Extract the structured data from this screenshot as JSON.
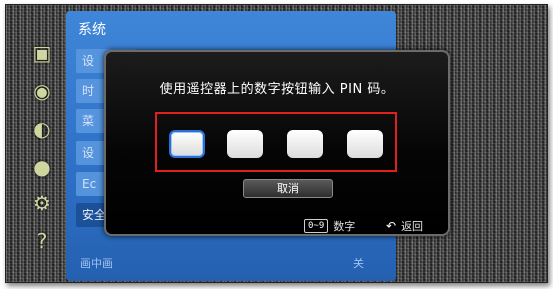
{
  "system_menu": {
    "title": "系统",
    "items": [
      {
        "label": "设"
      },
      {
        "label": "时"
      },
      {
        "label": "菜"
      },
      {
        "label": "设"
      },
      {
        "label": "Ec"
      },
      {
        "label": "安全"
      }
    ],
    "bottom_label": "画中画",
    "bottom_value": "关"
  },
  "side_icons": [
    "picture-icon",
    "sound-icon",
    "channel-icon",
    "globe-icon",
    "gear-icon",
    "help-icon"
  ],
  "pin_dialog": {
    "prompt": "使用遥控器上的数字按钮输入 PIN 码。",
    "pin_digits": [
      "",
      "",
      "",
      ""
    ],
    "cancel_label": "取消",
    "footer": {
      "digits_key": "0~9",
      "digits_label": "数字",
      "return_label": "返回"
    }
  },
  "colors": {
    "highlight": "#e02020",
    "menu_blue": "#2d70c6",
    "active_pin": "#2b6fd0"
  }
}
